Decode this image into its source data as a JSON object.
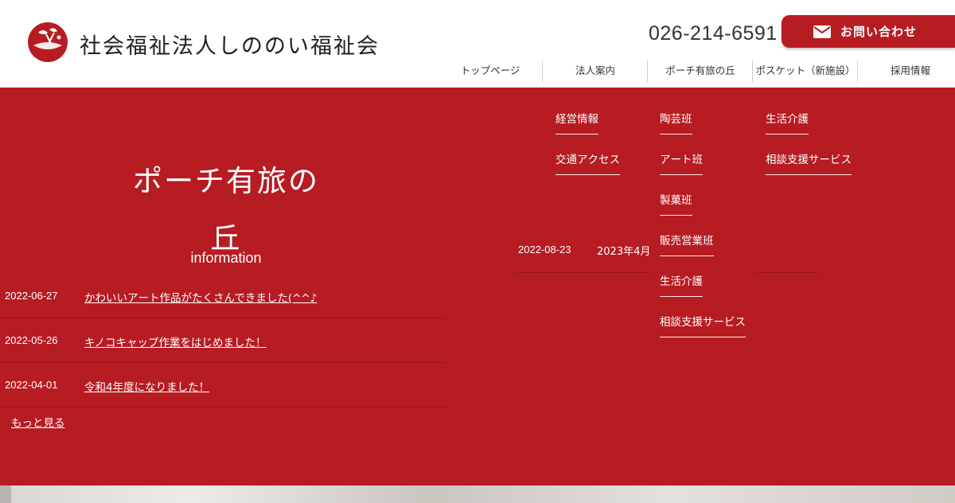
{
  "brand": {
    "title": "社会福祉法人しののい福祉会",
    "logo_icon": "logo-emblem",
    "accent_color": "#b71c23"
  },
  "header": {
    "phone": "026-214-6591",
    "contact_label": "お問い合わせ",
    "contact_icon": "mail-icon"
  },
  "nav": {
    "items": [
      {
        "label": "トップページ"
      },
      {
        "label": "法人案内"
      },
      {
        "label": "ポーチ有旅の丘"
      },
      {
        "label": "ポスケット（新施設）"
      },
      {
        "label": "採用情報"
      }
    ]
  },
  "dropdowns": {
    "corporate": [
      "経営情報",
      "交通アクセス"
    ],
    "porch": [
      "陶芸班",
      "アート班",
      "製菓班",
      "販売営業班",
      "生活介護",
      "相談支援サービス"
    ],
    "posket": [
      "生活介護",
      "相談支援サービス"
    ]
  },
  "section": {
    "title": "ポーチ有旅の丘",
    "subtitle": "information",
    "news": [
      {
        "date": "2022-06-27",
        "title": "かわいいアート作品がたくさんできました(^^♪"
      },
      {
        "date": "2022-05-26",
        "title": "キノコキャップ作業をはじめました！"
      },
      {
        "date": "2022-04-01",
        "title": "令和4年度になりました！"
      }
    ],
    "more_label": "もっと見る"
  },
  "right_news": {
    "date": "2022-08-23",
    "title": "2023年4月"
  }
}
